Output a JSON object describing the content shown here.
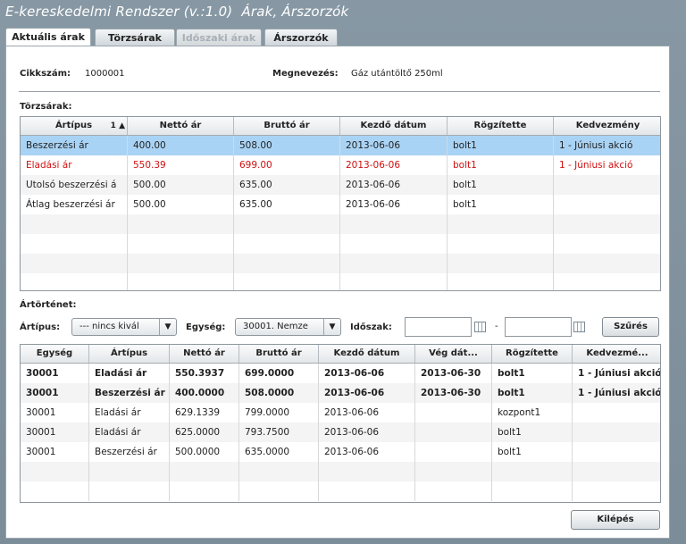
{
  "app": {
    "title": "E-kereskedelmi Rendszer (v.:1.0)",
    "subtitle": "Árak, Árszorzók"
  },
  "tabs": [
    {
      "label": "Aktuális árak"
    },
    {
      "label": "Törzsárak"
    },
    {
      "label": "Időszaki árak"
    },
    {
      "label": "Árszorzók"
    }
  ],
  "product": {
    "code_label": "Cikkszám:",
    "code": "1000001",
    "name_label": "Megnevezés:",
    "name": "Gáz utántöltő 250ml"
  },
  "base_prices": {
    "section_label": "Törzsárak:",
    "sort_indicator": "1 ▲",
    "columns": [
      "Ártípus",
      "Nettó ár",
      "Bruttó ár",
      "Kezdő dátum",
      "Rögzítette",
      "Kedvezmény"
    ],
    "rows": [
      [
        "Beszerzési ár",
        "400.00",
        "508.00",
        "2013-06-06",
        "bolt1",
        "1 - Júniusi akció"
      ],
      [
        "Eladási ár",
        "550.39",
        "699.00",
        "2013-06-06",
        "bolt1",
        "1 - Júniusi akció"
      ],
      [
        "Utolsó beszerzési á",
        "500.00",
        "635.00",
        "2013-06-06",
        "bolt1",
        ""
      ],
      [
        "Átlag beszerzési ár",
        "500.00",
        "635.00",
        "2013-06-06",
        "bolt1",
        ""
      ]
    ]
  },
  "history": {
    "section_label": "Ártörténet:",
    "type_label": "Ártípus:",
    "type_value": "--- nincs kivál",
    "unit_label": "Egység:",
    "unit_value": "30001. Nemze",
    "period_label": "Időszak:",
    "period_sep": "-",
    "filter_button": "Szűrés",
    "columns": [
      "Egység",
      "Ártípus",
      "Nettó ár",
      "Bruttó ár",
      "Kezdő dátum",
      "Vég dát...",
      "Rögzítette",
      "Kedvezmé..."
    ],
    "rows": [
      [
        "30001",
        "Eladási ár",
        "550.3937",
        "699.0000",
        "2013-06-06",
        "2013-06-30",
        "bolt1",
        "1 - Júniusi akció"
      ],
      [
        "30001",
        "Beszerzési ár",
        "400.0000",
        "508.0000",
        "2013-06-06",
        "2013-06-30",
        "bolt1",
        "1 - Júniusi akció"
      ],
      [
        "30001",
        "Eladási ár",
        "629.1339",
        "799.0000",
        "2013-06-06",
        "",
        "kozpont1",
        ""
      ],
      [
        "30001",
        "Eladási ár",
        "625.0000",
        "793.7500",
        "2013-06-06",
        "",
        "bolt1",
        ""
      ],
      [
        "30001",
        "Beszerzési ár",
        "500.0000",
        "635.0000",
        "2013-06-06",
        "",
        "bolt1",
        ""
      ]
    ]
  },
  "exit_button": "Kilépés",
  "colors": {
    "selected_row": "#a9d3f5",
    "discount_red": "#d01010",
    "background": "#7d8f9b"
  }
}
